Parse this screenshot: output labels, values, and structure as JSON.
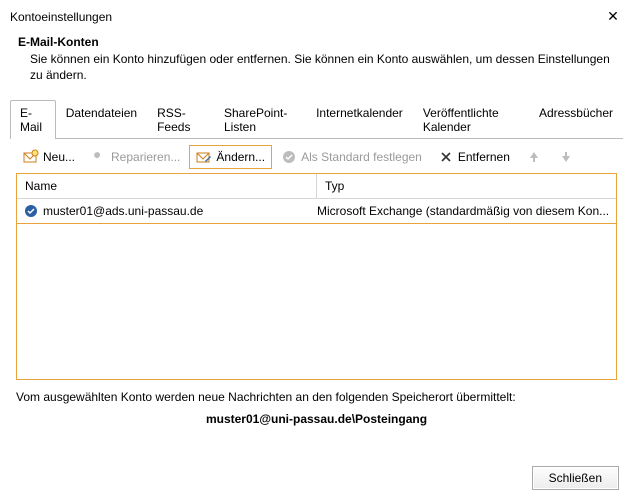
{
  "window": {
    "title": "Kontoeinstellungen"
  },
  "header": {
    "title": "E-Mail-Konten",
    "subtitle": "Sie können ein Konto hinzufügen oder entfernen. Sie können ein Konto auswählen, um dessen Einstellungen zu ändern."
  },
  "tabs": {
    "email": "E-Mail",
    "datafiles": "Datendateien",
    "rss": "RSS-Feeds",
    "sharepoint": "SharePoint-Listen",
    "ical": "Internetkalender",
    "pubcal": "Veröffentlichte Kalender",
    "addr": "Adressbücher"
  },
  "toolbar": {
    "new": "Neu...",
    "repair": "Reparieren...",
    "change": "Ändern...",
    "default": "Als Standard festlegen",
    "remove": "Entfernen"
  },
  "table": {
    "col_name": "Name",
    "col_type": "Typ",
    "rows": [
      {
        "name": "muster01@ads.uni-passau.de",
        "type": "Microsoft Exchange (standardmäßig von diesem Kon..."
      }
    ]
  },
  "delivery": {
    "msg": "Vom ausgewählten Konto werden neue Nachrichten an den folgenden Speicherort übermittelt:",
    "path": "muster01@uni-passau.de\\Posteingang"
  },
  "footer": {
    "close": "Schließen"
  }
}
